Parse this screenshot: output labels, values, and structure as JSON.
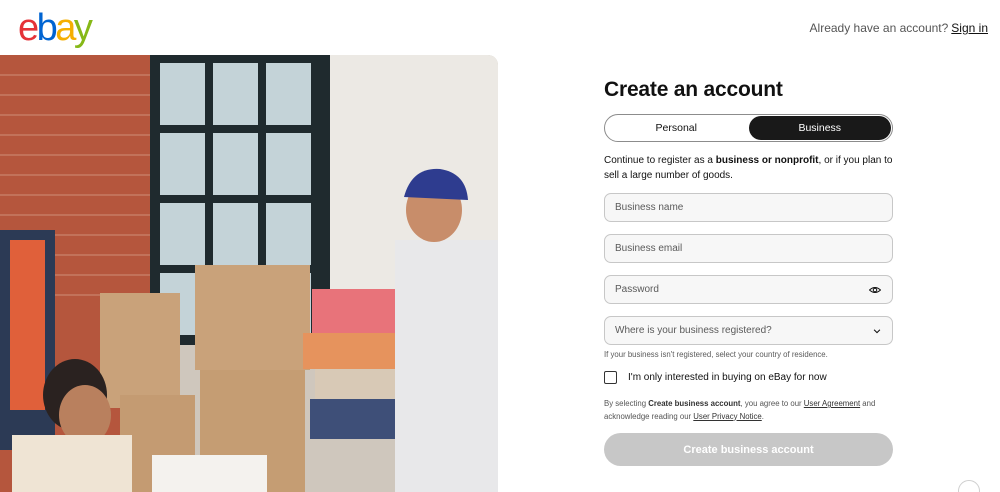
{
  "header": {
    "logo_text": [
      "e",
      "b",
      "a",
      "y"
    ],
    "signin_prompt": "Already have an account?",
    "signin_link": "Sign in"
  },
  "form": {
    "title": "Create an account",
    "tabs": [
      {
        "label": "Personal",
        "active": false
      },
      {
        "label": "Business",
        "active": true
      }
    ],
    "description": {
      "prefix": "Continue to register as a ",
      "emphasis": "business or nonprofit",
      "suffix": ", or if you plan to sell a large number of goods."
    },
    "fields": {
      "business_name": {
        "placeholder": "Business name",
        "value": ""
      },
      "business_email": {
        "placeholder": "Business email",
        "value": ""
      },
      "password": {
        "placeholder": "Password",
        "value": ""
      },
      "country": {
        "placeholder": "Where is your business registered?"
      }
    },
    "country_hint": "If your business isn't registered, select your country of residence.",
    "buying_only_checkbox": {
      "label": "I'm only interested in buying on eBay for now",
      "checked": false
    },
    "legal": {
      "prefix": "By selecting ",
      "button_ref": "Create business account",
      "middle": ", you agree to our ",
      "user_agreement": "User Agreement",
      "and_text": " and acknowledge reading our ",
      "privacy_notice": "User Privacy Notice",
      "end": "."
    },
    "submit_label": "Create business account"
  },
  "icons": {
    "password_visibility": "eye-icon",
    "country_dropdown": "chevron-down-icon"
  },
  "colors": {
    "ebay_red": "#e53238",
    "ebay_blue": "#0064d2",
    "ebay_yellow": "#f5af02",
    "ebay_green": "#86b817",
    "active_tab": "#191919",
    "submit_disabled": "#c7c7c7"
  }
}
